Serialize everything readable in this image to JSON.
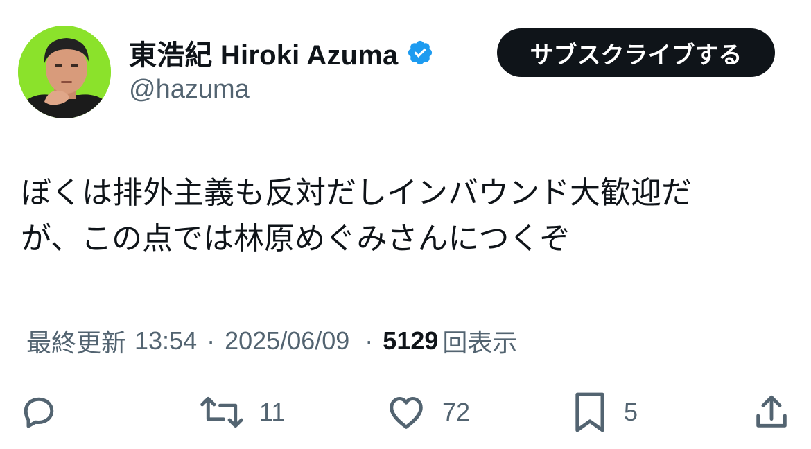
{
  "author": {
    "display_name": "東浩紀 Hiroki Azuma",
    "handle": "@hazuma",
    "verified": true,
    "avatar_bg": "#8be22b"
  },
  "subscribe_label": "サブスクライブする",
  "tweet": {
    "lines": [
      "ぼくは排外主義も反対だしインバウンド大歓迎だ",
      "が、この点では林原めぐみさんにつくぞ"
    ]
  },
  "meta": {
    "updated_label": "最終更新",
    "time": "13:54",
    "separator": "·",
    "date": "2025/06/09",
    "views_count": "5129",
    "views_label": "回表示"
  },
  "actions": {
    "reply_count": "",
    "retweet_count": "11",
    "like_count": "72",
    "bookmark_count": "5"
  },
  "colors": {
    "text_primary": "#0f1419",
    "text_secondary": "#536471",
    "verified_blue": "#1d9bf0",
    "button_bg": "#0f1419"
  },
  "icons": [
    "verified-badge-icon",
    "reply-icon",
    "retweet-icon",
    "like-icon",
    "bookmark-icon",
    "share-icon"
  ]
}
